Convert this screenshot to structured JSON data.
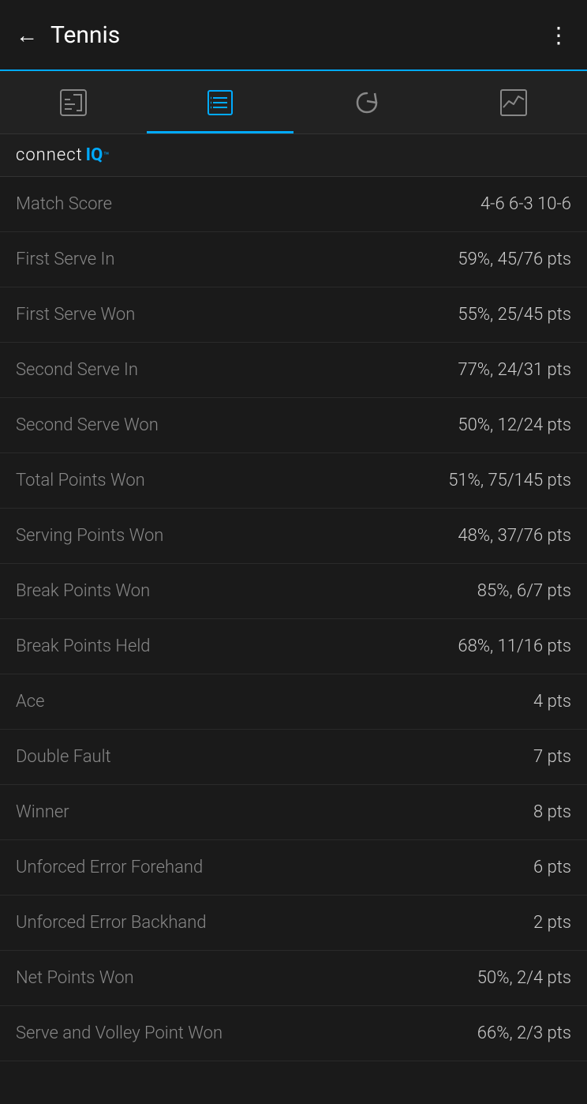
{
  "header": {
    "back_label": "←",
    "title": "Tennis",
    "menu_icon": "⋮"
  },
  "tabs": [
    {
      "id": "activity",
      "label": "Activity",
      "active": false
    },
    {
      "id": "list",
      "label": "List",
      "active": true
    },
    {
      "id": "replay",
      "label": "Replay",
      "active": false
    },
    {
      "id": "chart",
      "label": "Chart",
      "active": false
    }
  ],
  "banner": {
    "connect": "connect",
    "iq": "IQ",
    "trademark": "™"
  },
  "stats": [
    {
      "label": "Match Score",
      "value": "4-6 6-3 10-6"
    },
    {
      "label": "First Serve In",
      "value": "59%, 45/76 pts"
    },
    {
      "label": "First Serve Won",
      "value": "55%, 25/45 pts"
    },
    {
      "label": "Second Serve In",
      "value": "77%, 24/31 pts"
    },
    {
      "label": "Second Serve Won",
      "value": "50%, 12/24 pts"
    },
    {
      "label": "Total Points Won",
      "value": "51%, 75/145 pts"
    },
    {
      "label": "Serving Points Won",
      "value": "48%, 37/76 pts"
    },
    {
      "label": "Break Points Won",
      "value": "85%, 6/7 pts"
    },
    {
      "label": "Break Points Held",
      "value": "68%, 11/16 pts"
    },
    {
      "label": "Ace",
      "value": "4 pts"
    },
    {
      "label": "Double Fault",
      "value": "7 pts"
    },
    {
      "label": "Winner",
      "value": "8 pts"
    },
    {
      "label": "Unforced Error Forehand",
      "value": "6 pts"
    },
    {
      "label": "Unforced Error Backhand",
      "value": "2 pts"
    },
    {
      "label": "Net Points Won",
      "value": "50%, 2/4 pts"
    },
    {
      "label": "Serve and Volley Point Won",
      "value": "66%, 2/3 pts"
    }
  ],
  "colors": {
    "accent": "#00aaff",
    "background": "#1a1a1a",
    "text_primary": "#ffffff",
    "text_secondary": "#888888",
    "text_value": "#cccccc"
  }
}
